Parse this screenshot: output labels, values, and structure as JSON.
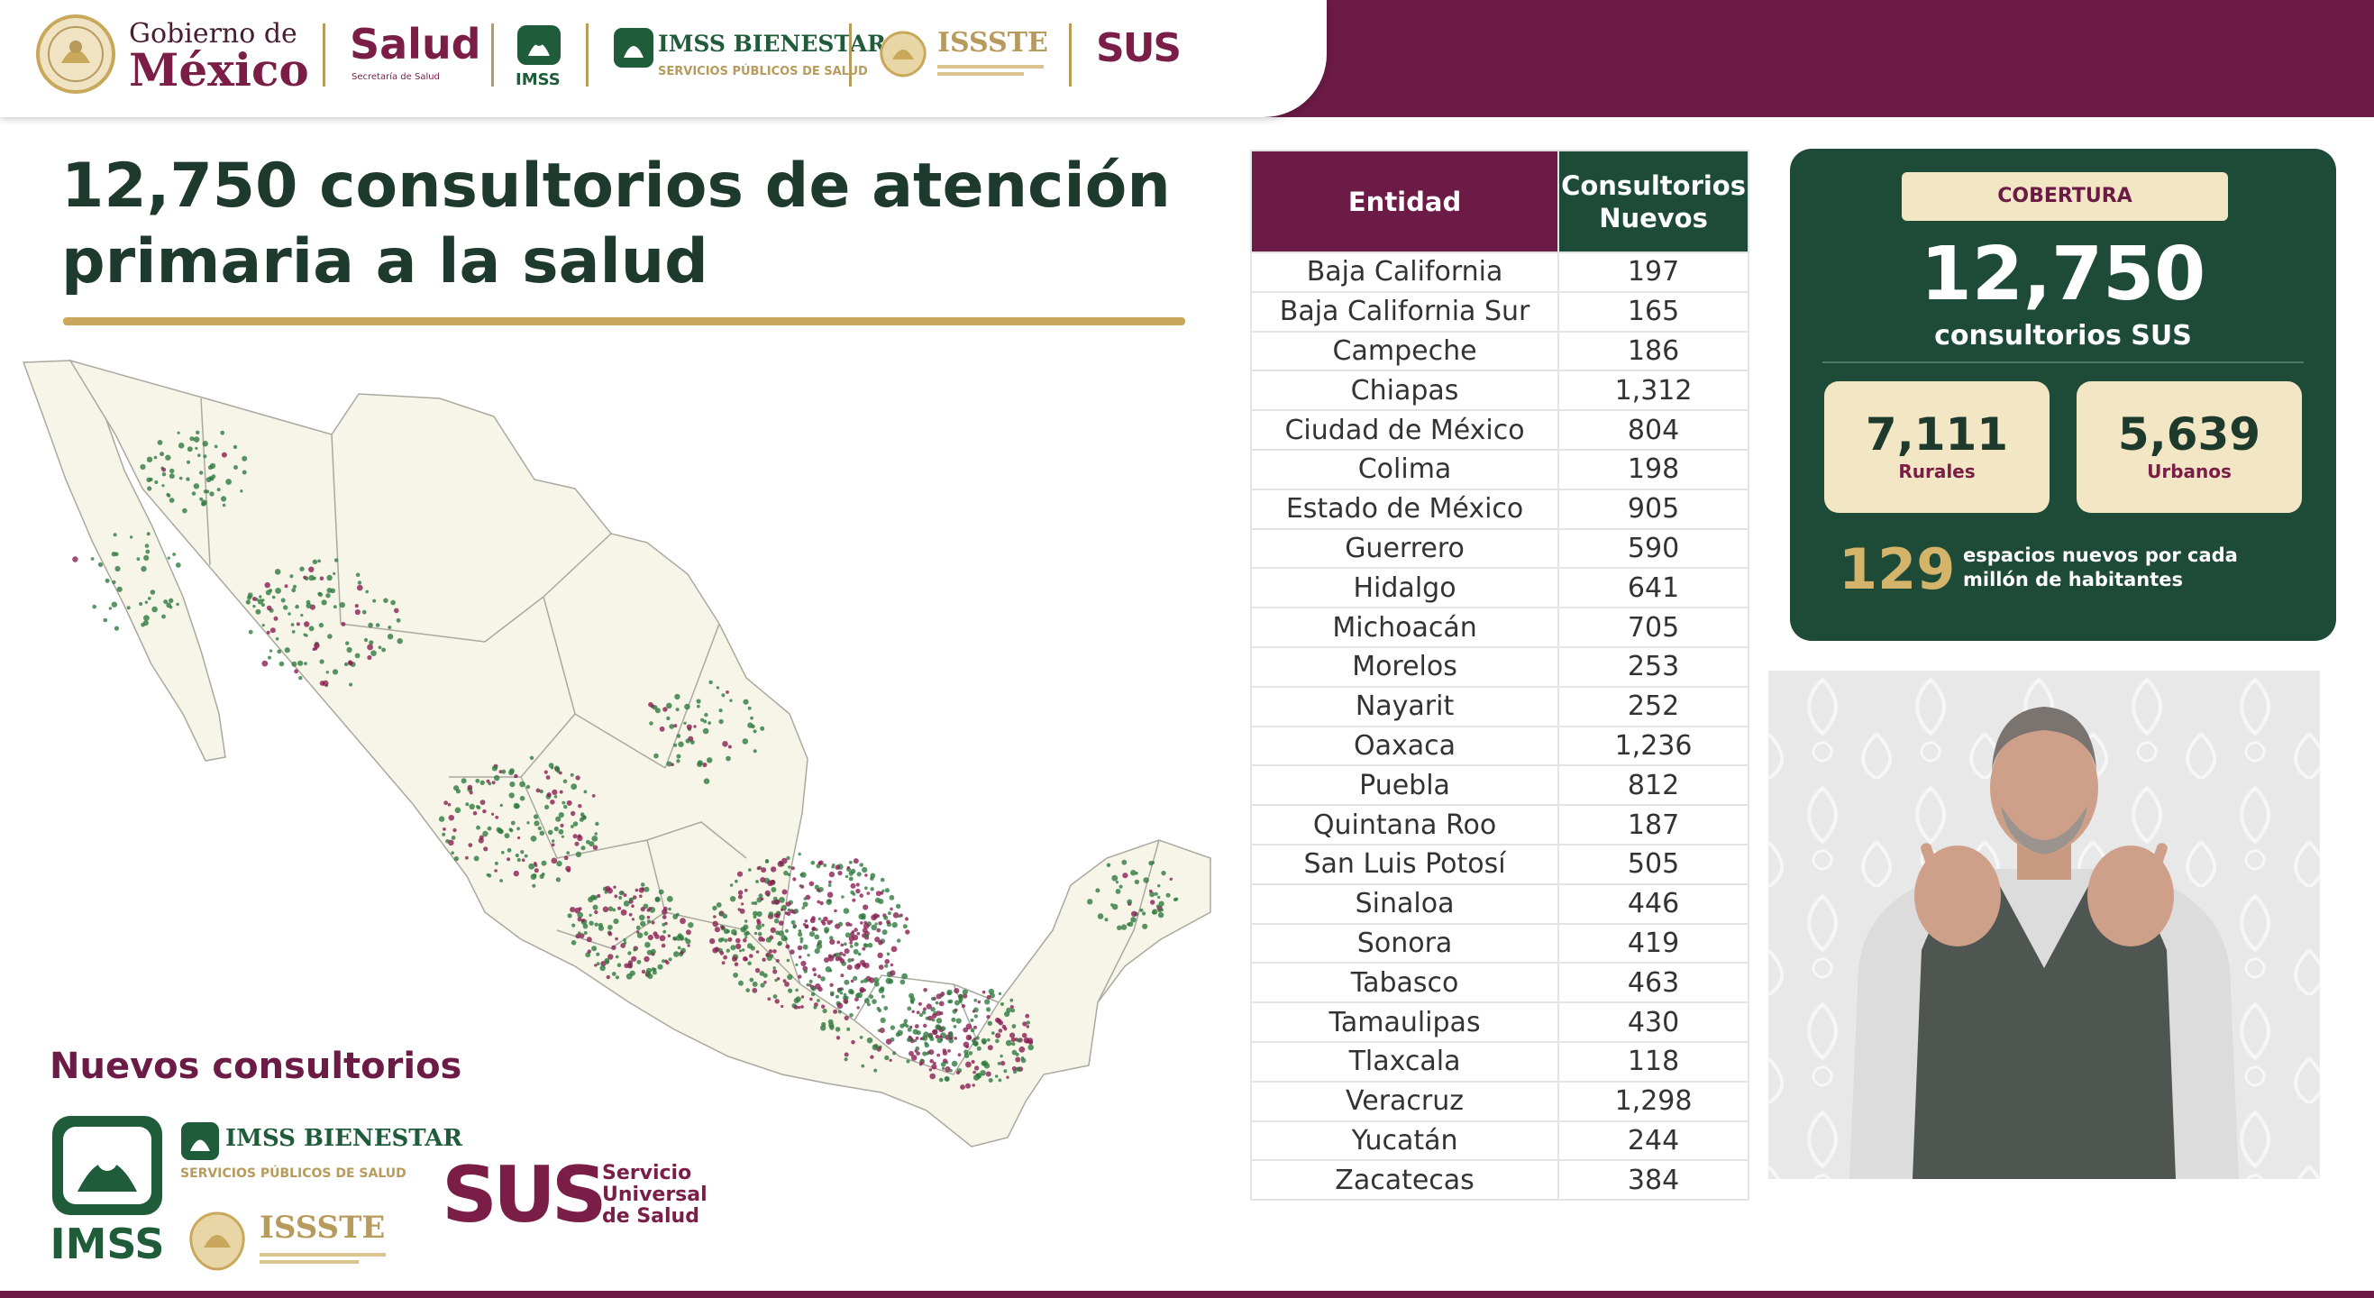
{
  "header": {
    "gobierno_line1": "Gobierno de",
    "gobierno_line2": "México",
    "salud_title": "Salud",
    "salud_subtitle": "Secretaría de Salud",
    "imss": "IMSS",
    "imss_bienestar": "IMSS BIENESTAR",
    "imss_bienestar_sub": "SERVICIOS PÚBLICOS DE SALUD",
    "issste": "ISSSTE",
    "sus": "SUS"
  },
  "title": "12,750 consultorios de atención primaria a la salud",
  "legend": {
    "title": "Nuevos consultorios",
    "imss": "IMSS",
    "imss_bienestar": "IMSS BIENESTAR",
    "imss_bienestar_sub": "SERVICIOS PÚBLICOS DE SALUD",
    "issste": "ISSSTE",
    "sus": "SUS",
    "sus_name": "Servicio Universal de Salud"
  },
  "table": {
    "col_entidad": "Entidad",
    "col_consultorios": "Consultorios Nuevos",
    "rows": [
      {
        "entidad": "Baja California",
        "valor": "197"
      },
      {
        "entidad": "Baja California Sur",
        "valor": "165"
      },
      {
        "entidad": "Campeche",
        "valor": "186"
      },
      {
        "entidad": "Chiapas",
        "valor": "1,312"
      },
      {
        "entidad": "Ciudad de México",
        "valor": "804"
      },
      {
        "entidad": "Colima",
        "valor": "198"
      },
      {
        "entidad": "Estado de México",
        "valor": "905"
      },
      {
        "entidad": "Guerrero",
        "valor": "590"
      },
      {
        "entidad": "Hidalgo",
        "valor": "641"
      },
      {
        "entidad": "Michoacán",
        "valor": "705"
      },
      {
        "entidad": "Morelos",
        "valor": "253"
      },
      {
        "entidad": "Nayarit",
        "valor": "252"
      },
      {
        "entidad": "Oaxaca",
        "valor": "1,236"
      },
      {
        "entidad": "Puebla",
        "valor": "812"
      },
      {
        "entidad": "Quintana Roo",
        "valor": "187"
      },
      {
        "entidad": "San Luis Potosí",
        "valor": "505"
      },
      {
        "entidad": "Sinaloa",
        "valor": "446"
      },
      {
        "entidad": "Sonora",
        "valor": "419"
      },
      {
        "entidad": "Tabasco",
        "valor": "463"
      },
      {
        "entidad": "Tamaulipas",
        "valor": "430"
      },
      {
        "entidad": "Tlaxcala",
        "valor": "118"
      },
      {
        "entidad": "Veracruz",
        "valor": "1,298"
      },
      {
        "entidad": "Yucatán",
        "valor": "244"
      },
      {
        "entidad": "Zacatecas",
        "valor": "384"
      }
    ]
  },
  "cobertura": {
    "label": "COBERTURA",
    "total": "12,750",
    "total_sub": "consultorios SUS",
    "rurales_value": "7,111",
    "rurales_label": "Rurales",
    "urbanos_value": "5,639",
    "urbanos_label": "Urbanos",
    "per_million_value": "129",
    "per_million_desc": "espacios nuevos por cada millón de habitantes"
  },
  "colors": {
    "guinda": "#6b1b45",
    "verde": "#1e4a38",
    "dorado": "#c9a85c",
    "crema": "#f2e6c4"
  }
}
